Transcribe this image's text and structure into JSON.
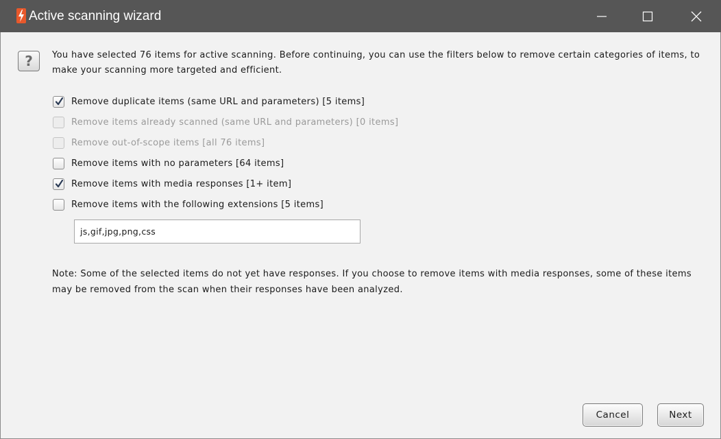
{
  "window": {
    "title": "Active scanning wizard",
    "controls": {
      "minimize": "minimize-icon",
      "maximize": "maximize-icon",
      "close": "close-icon"
    }
  },
  "intro": {
    "icon": "question-icon",
    "text": "You have selected 76 items for active scanning. Before continuing, you can use the filters below to remove certain categories of items, to make your scanning more targeted and efficient."
  },
  "options": [
    {
      "label": "Remove duplicate items (same URL and parameters) [5 items]",
      "checked": true,
      "enabled": true
    },
    {
      "label": "Remove items already scanned (same URL and parameters) [0 items]",
      "checked": false,
      "enabled": false
    },
    {
      "label": "Remove out-of-scope items [all 76 items]",
      "checked": false,
      "enabled": false
    },
    {
      "label": "Remove items with no parameters [64 items]",
      "checked": false,
      "enabled": true
    },
    {
      "label": "Remove items with media responses [1+ item]",
      "checked": true,
      "enabled": true
    },
    {
      "label": "Remove items with the following extensions [5 items]",
      "checked": false,
      "enabled": true
    }
  ],
  "extensions": {
    "value": "js,gif,jpg,png,css"
  },
  "note": "Note: Some of the selected items do not yet have responses. If you choose to remove items with media responses, some of these items may be removed from the scan when their responses have been analyzed.",
  "buttons": {
    "cancel": "Cancel",
    "next": "Next"
  },
  "colors": {
    "titlebar": "#565656",
    "accent": "#e8582b",
    "background": "#f2f2f2"
  }
}
